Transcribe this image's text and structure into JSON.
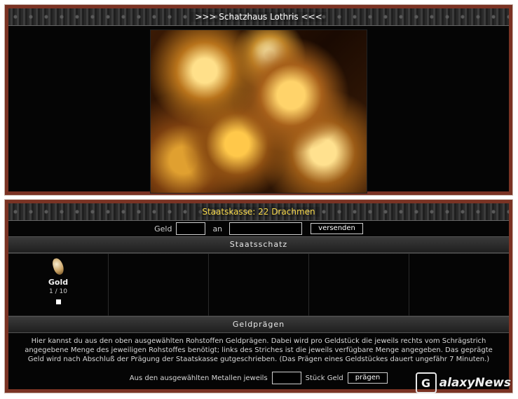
{
  "treasury": {
    "title": ">>> Schatzhaus Lothris <<<",
    "image_alt": "Goldschatz"
  },
  "state": {
    "balance_title": "Staatskasse: 22 Drachmen",
    "transfer": {
      "money_label": "Geld",
      "money_value": "",
      "to_label": "an",
      "recipient_value": "",
      "send_button": "versenden"
    },
    "treasure_header": "Staatsschatz",
    "resources": [
      {
        "name": "Gold",
        "count": "1 / 10",
        "icon": "gold-nugget-icon",
        "checked": false
      }
    ]
  },
  "minting": {
    "header": "Geldprägen",
    "description": "Hier kannst du aus den oben ausgewählten Rohstoffen Geldprägen. Dabei wird pro Geldstück die jeweils rechts vom Schrägstrich angegebene Menge des jeweiligen Rohstoffes benötigt; links des Striches ist die jeweils verfügbare Menge angegeben. Das geprägte Geld wird nach Abschluß der Prägung der Staatskasse gutgeschrieben. (Das Prägen eines Geldstückes dauert ungefähr 7 Minuten.)",
    "prefix": "Aus den ausgewählten Metallen jeweils",
    "amount_value": "",
    "suffix": "Stück Geld",
    "mint_button": "prägen"
  },
  "watermark": {
    "letter": "G",
    "text": "alaxyNews"
  },
  "colors": {
    "frame": "#7a3324",
    "accent_yellow": "#f6d84a",
    "background": "#050505"
  }
}
